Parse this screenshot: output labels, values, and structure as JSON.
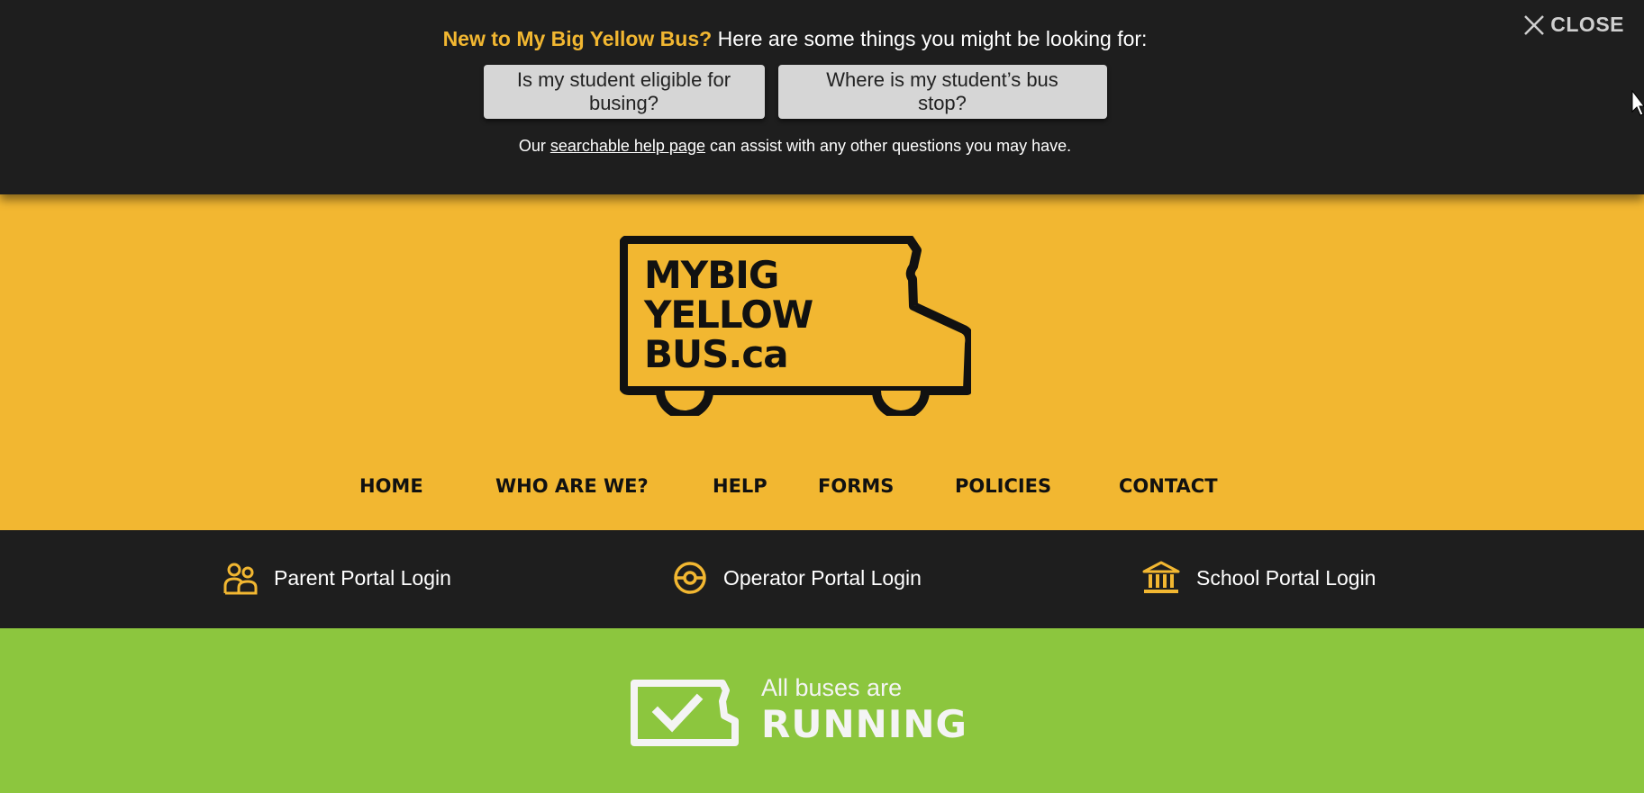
{
  "banner": {
    "headline_accent": "New to My Big Yellow Bus?",
    "headline_rest": " Here are some things you might be looking for:",
    "buttons": [
      {
        "label": "Is my student eligible for busing?"
      },
      {
        "label": "Where is my student’s bus stop?"
      }
    ],
    "help_prefix": "Our ",
    "help_link": "searchable help page",
    "help_suffix": " can assist with any other questions you may have.",
    "close_label": "CLOSE"
  },
  "logo": {
    "line1": "MYBIG",
    "line2": "YELLOW",
    "line3": "BUS.ca",
    "icon": "school-bus-logo"
  },
  "nav": {
    "items": [
      {
        "label": "HOME"
      },
      {
        "label": "WHO ARE WE?"
      },
      {
        "label": "HELP"
      },
      {
        "label": "FORMS"
      },
      {
        "label": "POLICIES"
      },
      {
        "label": "CONTACT"
      }
    ]
  },
  "portals": [
    {
      "label": "Parent Portal Login",
      "icon": "parents-icon"
    },
    {
      "label": "Operator Portal Login",
      "icon": "steering-wheel-icon"
    },
    {
      "label": "School Portal Login",
      "icon": "school-building-icon"
    }
  ],
  "status": {
    "line1": "All buses are",
    "line2": "RUNNING",
    "icon": "bus-check-icon"
  },
  "colors": {
    "brand_yellow": "#f2b731",
    "dark": "#1e1e1e",
    "status_green": "#8cc63e"
  }
}
